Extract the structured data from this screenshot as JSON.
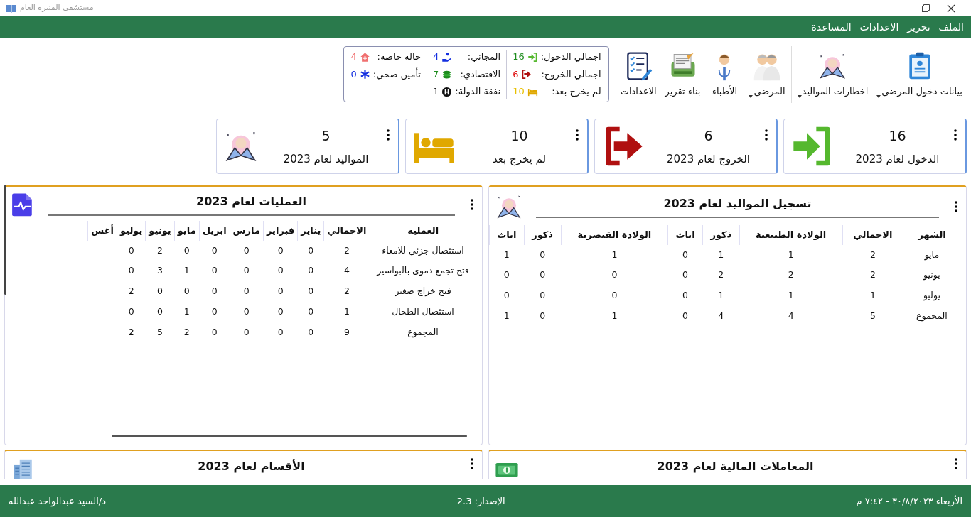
{
  "window": {
    "title": "مستشفى المنيرة العام"
  },
  "menu": [
    "الملف",
    "تحرير",
    "الاعدادات",
    "المساعدة"
  ],
  "toolbar": [
    {
      "label": "بيانات دخول المرضى",
      "kind": "clipboard",
      "dropdown": true
    },
    {
      "label": "اخطارات المواليد",
      "kind": "baby",
      "dropdown": true
    },
    {
      "label": "المرضى",
      "kind": "people",
      "dropdown": true
    },
    {
      "label": "الأطباء",
      "kind": "doctor",
      "dropdown": false
    },
    {
      "label": "بناء تقرير",
      "kind": "report",
      "dropdown": false
    },
    {
      "label": "الاعدادات",
      "kind": "checklist",
      "dropdown": false
    }
  ],
  "summary": [
    [
      {
        "label": "اجمالي الدخول:",
        "value": "16",
        "kind": "enter",
        "color": "#1e8c1e"
      },
      {
        "label": "اجمالي الخروج:",
        "value": "6",
        "kind": "exit",
        "color": "#e01010"
      },
      {
        "label": "لم يخرج بعد:",
        "value": "10",
        "kind": "bed",
        "color": "#e8c000"
      }
    ],
    [
      {
        "label": "المجاني:",
        "value": "4",
        "kind": "hand",
        "color": "#1530e0"
      },
      {
        "label": "الاقتصادي:",
        "value": "7",
        "kind": "coins",
        "color": "#1e8c1e"
      },
      {
        "label": "نفقة الدولة:",
        "value": "1",
        "kind": "hospital",
        "color": "#111111"
      }
    ],
    [
      {
        "label": "حالة خاصة:",
        "value": "4",
        "kind": "house",
        "color": "#f07070"
      },
      {
        "label": "تأمين صحي:",
        "value": "0",
        "kind": "asterisk",
        "color": "#1530e0"
      }
    ]
  ],
  "stats": [
    {
      "value": "16",
      "label": "الدخول لعام 2023",
      "kind": "enter"
    },
    {
      "value": "6",
      "label": "الخروج لعام 2023",
      "kind": "exit"
    },
    {
      "value": "10",
      "label": "لم يخرج بعد",
      "kind": "bed"
    },
    {
      "value": "5",
      "label": "المواليد لعام 2023",
      "kind": "baby"
    }
  ],
  "panels": [
    {
      "title": "تسجيل المواليد لعام 2023",
      "kind": "baby",
      "columns": [
        "الشهر",
        "الاجمالي",
        "الولادة الطبيعية",
        "ذكور",
        "اناث",
        "الولادة القيصرية",
        "ذكور",
        "اناث"
      ],
      "rows": [
        [
          "مايو",
          "2",
          "1",
          "1",
          "0",
          "1",
          "0",
          "1"
        ],
        [
          "يونيو",
          "2",
          "2",
          "2",
          "0",
          "0",
          "0",
          "0"
        ],
        [
          "يوليو",
          "1",
          "1",
          "1",
          "0",
          "0",
          "0",
          "0"
        ],
        [
          "المجموع",
          "5",
          "4",
          "4",
          "0",
          "1",
          "0",
          "1"
        ]
      ]
    },
    {
      "title": "العمليات لعام 2023",
      "kind": "pulse",
      "scrollbar": true,
      "columns": [
        "العملية",
        "الاجمالي",
        "يناير",
        "فبراير",
        "مارس",
        "ابريل",
        "مايو",
        "يونيو",
        "يوليو",
        "أغس"
      ],
      "rows": [
        [
          "استئصال جزئى للامعاء",
          "2",
          "0",
          "0",
          "0",
          "0",
          "0",
          "2",
          "0"
        ],
        [
          "فتح تجمع دموى بالبواسير",
          "4",
          "0",
          "0",
          "0",
          "0",
          "1",
          "3",
          "0"
        ],
        [
          "فتح خراج صغير",
          "2",
          "0",
          "0",
          "0",
          "0",
          "0",
          "0",
          "2"
        ],
        [
          "استئصال الطحال",
          "1",
          "0",
          "0",
          "0",
          "0",
          "1",
          "0",
          "0"
        ],
        [
          "المجموع",
          "9",
          "0",
          "0",
          "0",
          "0",
          "2",
          "5",
          "2"
        ]
      ]
    }
  ],
  "bottom_panels": [
    {
      "title": "المعاملات المالية لعام 2023",
      "kind": "money"
    },
    {
      "title": "الأقسام لعام 2023",
      "kind": "building"
    }
  ],
  "status_bar": {
    "date": "الأربعاء ٣٠/٨/٢٠٢٣ - ٧:٤٢ م",
    "version": "الإصدار: 2.3",
    "user": "د/السيد عبدالواحد عبدالله"
  }
}
